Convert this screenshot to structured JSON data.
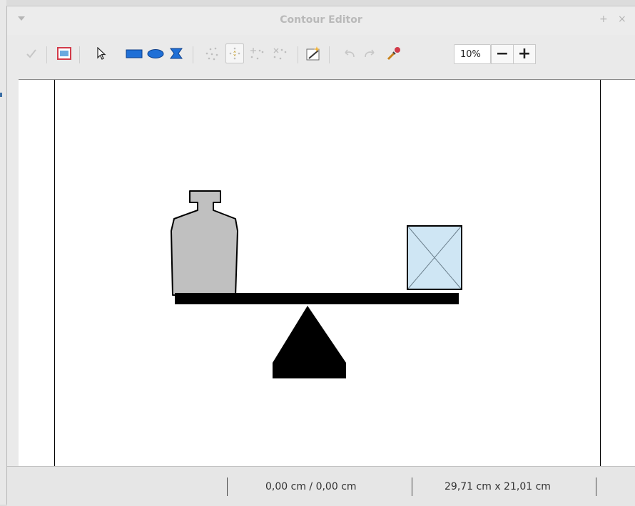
{
  "window": {
    "title": "Contour Editor",
    "pin_glyph": "+",
    "close_glyph": "×"
  },
  "toolbar": {
    "tools": [
      {
        "name": "apply-icon",
        "label": "Apply"
      },
      {
        "name": "workspace-icon",
        "label": "Workspace"
      },
      {
        "name": "select-icon",
        "label": "Select"
      },
      {
        "name": "rectangle-icon",
        "label": "Rectangle"
      },
      {
        "name": "ellipse-icon",
        "label": "Ellipse"
      },
      {
        "name": "polygon-icon",
        "label": "Polygon"
      },
      {
        "name": "points-icon",
        "label": "Points"
      },
      {
        "name": "move-points-icon",
        "label": "Move Points"
      },
      {
        "name": "insert-points-icon",
        "label": "Insert Points"
      },
      {
        "name": "delete-points-icon",
        "label": "Delete Points"
      },
      {
        "name": "auto-contour-icon",
        "label": "AutoContour"
      },
      {
        "name": "undo-icon",
        "label": "Undo"
      },
      {
        "name": "redo-icon",
        "label": "Redo"
      },
      {
        "name": "pipette-icon",
        "label": "Pipette"
      }
    ],
    "zoom_value": "10%",
    "zoom_out_label": "−",
    "zoom_in_label": "+"
  },
  "statusbar": {
    "position": "0,00 cm / 0,00 cm",
    "size": "29,71 cm x 21,01 cm"
  },
  "colors": {
    "weight_fill": "#c0c0c0",
    "box_fill": "#cfe6f4",
    "beam_fill": "#000000"
  }
}
